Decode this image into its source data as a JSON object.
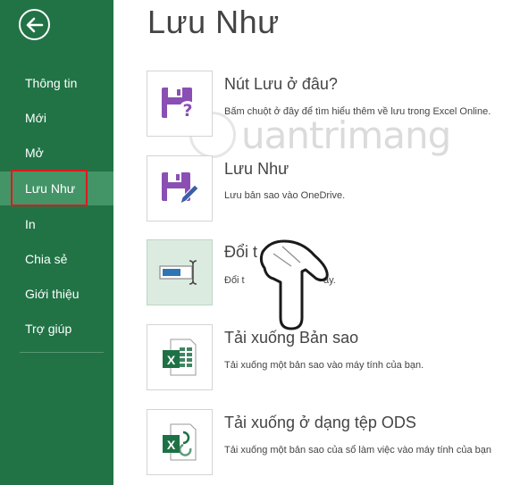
{
  "sidebar": {
    "items": [
      {
        "label": "Thông tin"
      },
      {
        "label": "Mới"
      },
      {
        "label": "Mở"
      },
      {
        "label": "Lưu Như"
      },
      {
        "label": "In"
      },
      {
        "label": "Chia sẻ"
      },
      {
        "label": "Giới thiệu"
      },
      {
        "label": "Trợ giúp"
      }
    ],
    "active_index": 3,
    "bg_color": "#217346",
    "active_color": "#439467",
    "highlight_color": "#e0191d"
  },
  "main": {
    "title": "Lưu Như",
    "options": [
      {
        "title": "Nút Lưu ở đâu?",
        "desc": "Bấm chuột ở đây để tìm hiểu thêm về lưu trong Excel Online.",
        "icon": "save-question-icon"
      },
      {
        "title": "Lưu Như",
        "desc": "Lưu bản sao vào OneDrive.",
        "icon": "save-edit-icon"
      },
      {
        "title": "Đổi t",
        "desc": "Đổi t",
        "desc_tail": "ay.",
        "icon": "rename-icon"
      },
      {
        "title": "Tải xuống Bản sao",
        "desc": "Tải xuống một bản sao vào máy tính của bạn.",
        "icon": "excel-file-icon"
      },
      {
        "title": "Tải xuống ở dạng tệp ODS",
        "desc": "Tải xuống một bản sao của sổ làm việc vào máy tính của bạn",
        "icon": "excel-ods-icon"
      }
    ]
  },
  "watermark": {
    "text": "uantrimang"
  },
  "colors": {
    "accent_purple": "#8a4fb3",
    "excel_green": "#1e7145",
    "text": "#444444"
  }
}
